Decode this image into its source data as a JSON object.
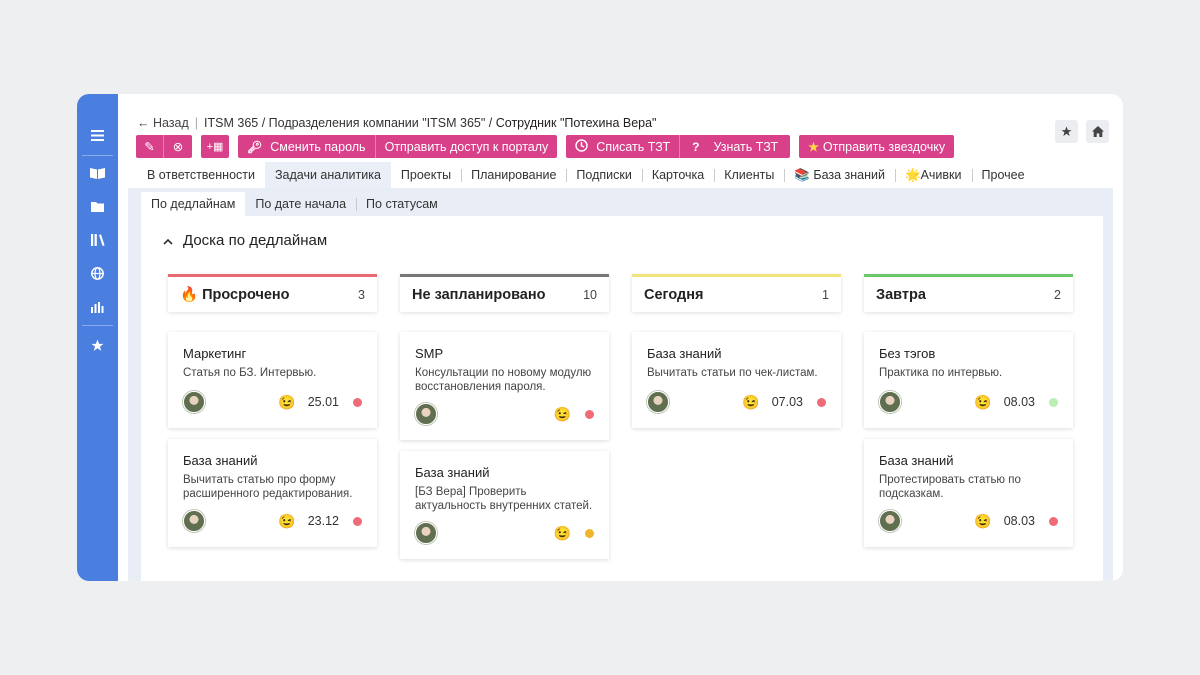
{
  "sidebar": {
    "icons": [
      "menu-icon",
      "book-icon",
      "folder-icon",
      "library-icon",
      "globe-icon",
      "chart-icon",
      "star-icon"
    ]
  },
  "breadcrumb": {
    "back": "← Назад",
    "path": "ITSM 365 / Подразделения компании \"ITSM 365\" /",
    "current": "Сотрудник \"Потехина Вера\""
  },
  "toolbar": {
    "edit_icon": "✎",
    "delete_icon": "⊗",
    "add_icon": "+▦",
    "change_password": "Сменить пароль",
    "send_access": "Отправить доступ к порталу",
    "write_off": "Списать ТЗТ",
    "learn": "Узнать ТЗТ",
    "send_star": "Отправить звездочку"
  },
  "tabs": [
    "В ответственности",
    "Задачи аналитика",
    "Проекты",
    "Планирование",
    "Подписки",
    "Карточка",
    "Клиенты",
    "📚 База знаний",
    "🌟Ачивки",
    "Прочее"
  ],
  "subtabs": [
    "По дедлайнам",
    "По дате начала",
    "По статусам"
  ],
  "board": {
    "title": "Доска по дедлайнам",
    "columns": [
      {
        "name": "🔥 Просрочено",
        "count": "3",
        "color": "#e86a73",
        "cards": [
          {
            "title": "Маркетинг",
            "desc": "Статья по БЗ. Интервью.",
            "emoji": "😉",
            "date": "25.01",
            "dot": "#ef6b77"
          },
          {
            "title": "База знаний",
            "desc": "Вычитать статью про форму расширенного редактирования.",
            "emoji": "😉",
            "date": "23.12",
            "dot": "#ef6b77"
          }
        ]
      },
      {
        "name": "Не запланировано",
        "count": "10",
        "color": "#777777",
        "cards": [
          {
            "title": "SMP",
            "desc": "Консультации по новому модулю восстановления пароля.",
            "emoji": "😉",
            "date": "",
            "dot": "#ef6b77"
          },
          {
            "title": "База знаний",
            "desc": "[БЗ Вера] Проверить актуальность внутренних статей.",
            "emoji": "😉",
            "date": "",
            "dot": "#f0b429"
          }
        ]
      },
      {
        "name": "Сегодня",
        "count": "1",
        "color": "#f0e47a",
        "cards": [
          {
            "title": "База знаний",
            "desc": "Вычитать статьи по чек-листам.",
            "emoji": "😉",
            "date": "07.03",
            "dot": "#ef6b77"
          }
        ]
      },
      {
        "name": "Завтра",
        "count": "2",
        "color": "#6cc76c",
        "cards": [
          {
            "title": "Без тэгов",
            "desc": "Практика по интервью.",
            "emoji": "😉",
            "date": "08.03",
            "dot": "#b9efb3"
          },
          {
            "title": "База знаний",
            "desc": "Протестировать статью по подсказкам.",
            "emoji": "😉",
            "date": "08.03",
            "dot": "#ef6b77"
          }
        ]
      }
    ]
  }
}
